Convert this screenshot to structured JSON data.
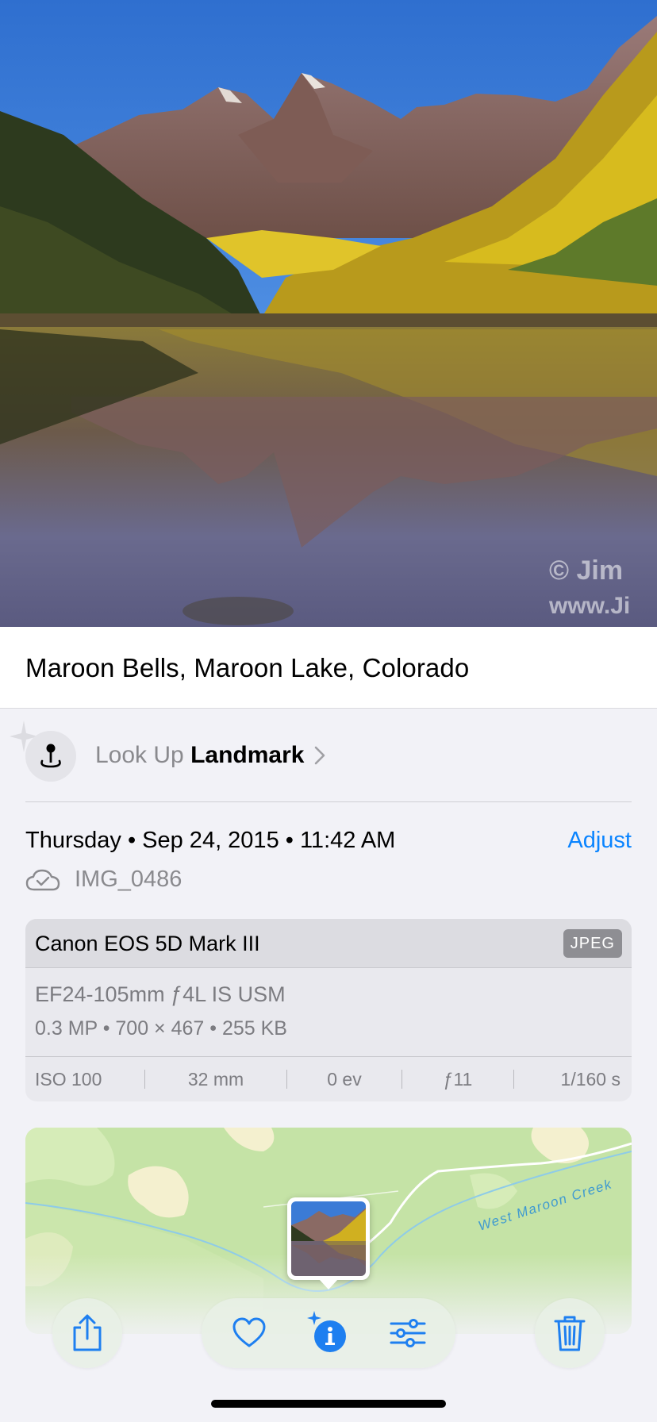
{
  "photo": {
    "watermark_line1": "© Jim",
    "watermark_line2": "www.Ji"
  },
  "caption": {
    "text": "Maroon Bells, Maroon Lake, Colorado"
  },
  "lookup": {
    "prefix": "Look Up ",
    "subject": "Landmark"
  },
  "date": {
    "text": "Thursday • Sep 24, 2015 • 11:42 AM",
    "adjust_label": "Adjust"
  },
  "file": {
    "name": "IMG_0486"
  },
  "camera": {
    "model": "Canon EOS 5D Mark III",
    "format_badge": "JPEG",
    "lens": "EF24-105mm ƒ4L IS USM",
    "specs": "0.3 MP  •  700 × 467  •  255 KB",
    "exif": {
      "iso": "ISO 100",
      "focal": "32 mm",
      "ev": "0 ev",
      "aperture": "ƒ11",
      "shutter": "1/160 s"
    }
  },
  "map": {
    "creek_label": "West Maroon Creek"
  },
  "colors": {
    "accent": "#0a84ff",
    "background": "#f2f2f7"
  },
  "toolbar": {
    "share": "share-icon",
    "favorite": "heart-icon",
    "info": "info-sparkle-icon",
    "adjust": "sliders-icon",
    "delete": "trash-icon"
  }
}
